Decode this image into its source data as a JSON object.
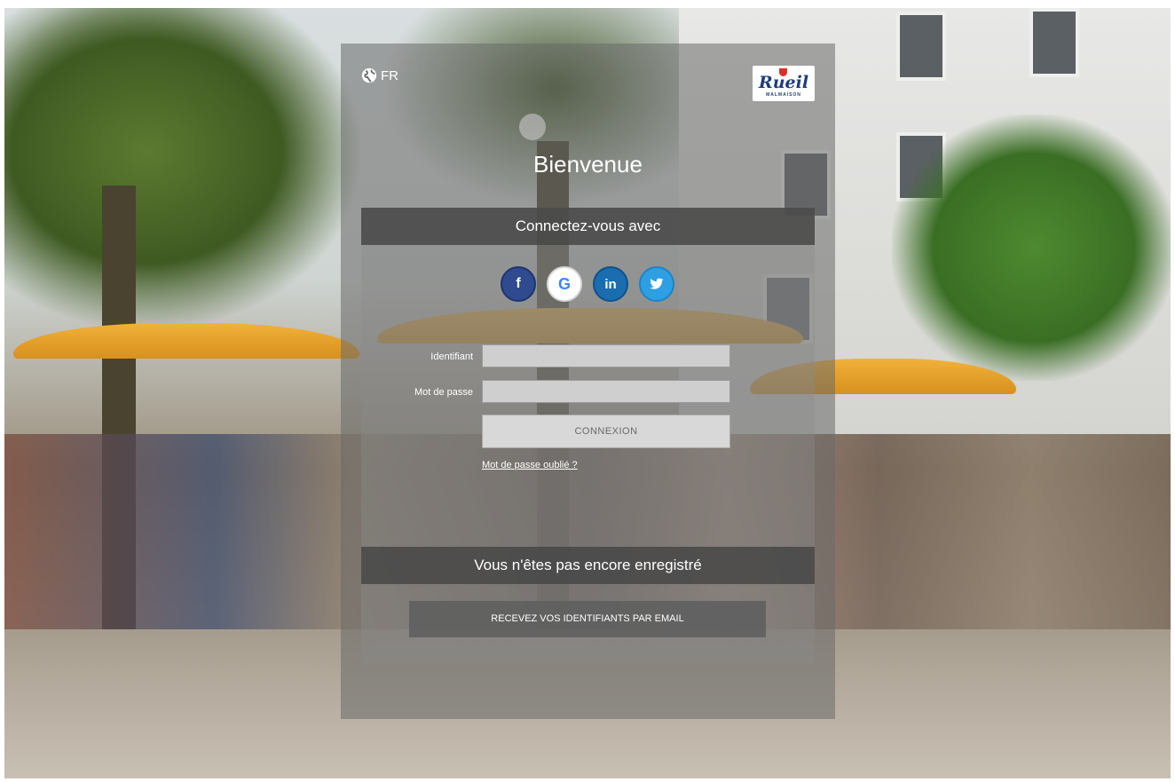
{
  "header": {
    "language": "FR",
    "logo_text": "Rueil",
    "logo_subtext": "MALMAISON",
    "title": "Bienvenue"
  },
  "social_login": {
    "heading": "Connectez-vous avec",
    "providers": [
      {
        "name": "facebook",
        "glyph": "f",
        "color": "#2f4a8e"
      },
      {
        "name": "google",
        "glyph": "G",
        "color": "#4285f4"
      },
      {
        "name": "linkedin",
        "glyph": "in",
        "color": "#1a6eb0"
      },
      {
        "name": "twitter",
        "glyph": "🐦",
        "color": "#2f9fe4"
      }
    ]
  },
  "login_form": {
    "username_label": "Identifiant",
    "username_value": "",
    "password_label": "Mot de passe",
    "password_value": "",
    "submit_label": "CONNEXION",
    "forgot_label": "Mot de passe oublié ?"
  },
  "register": {
    "heading": "Vous n'êtes pas encore enregistré",
    "email_button_label": "RECEVEZ VOS IDENTIFIANTS PAR EMAIL"
  }
}
